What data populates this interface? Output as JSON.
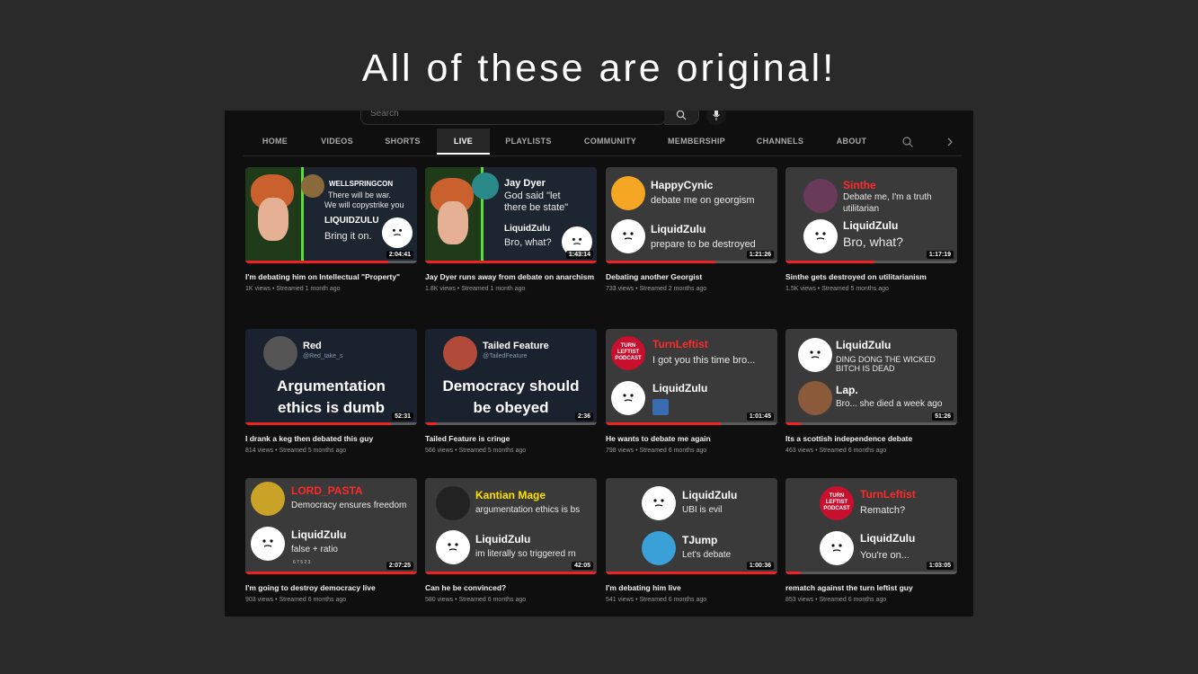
{
  "headline": "All of these are original!",
  "search": {
    "placeholder": "Search"
  },
  "tabs": [
    "HOME",
    "VIDEOS",
    "SHORTS",
    "LIVE",
    "PLAYLISTS",
    "COMMUNITY",
    "MEMBERSHIP",
    "CHANNELS",
    "ABOUT"
  ],
  "active_tab": "LIVE",
  "colors": {
    "accent_red": "#ff2a2a",
    "yellow": "#ffe100",
    "progress": "#e22222",
    "card_bg": "#3a3a3d"
  },
  "videos": [
    {
      "title": "I'm debating him on Intellectual \"Property\"",
      "meta": "1K views • Streamed 1 month ago",
      "duration": "2:04:41",
      "progress": 0.83,
      "thumb": {
        "n1": "WELLSPRINGCON",
        "l1": "There will be war.",
        "l1b": "We will copystrike you",
        "n2": "LIQUIDZULU",
        "l2": "Bring it on."
      }
    },
    {
      "title": "Jay Dyer runs away from debate on anarchism",
      "meta": "1.8K views • Streamed 1 month ago",
      "duration": "1:43:14",
      "progress": 1.0,
      "thumb": {
        "n1": "Jay Dyer",
        "l1": "God said \"let",
        "l1b": "there be state\"",
        "n2": "LiquidZulu",
        "l2": "Bro, what?"
      }
    },
    {
      "title": "Debating another Georgist",
      "meta": "733 views • Streamed 2 months ago",
      "duration": "1:21:26",
      "progress": 0.64,
      "thumb": {
        "n1": "HappyCynic",
        "l1": "debate me on georgism",
        "n2": "LiquidZulu",
        "l2": "prepare to be destroyed"
      }
    },
    {
      "title": "Sinthe gets destroyed on utilitarianism",
      "meta": "1.5K views • Streamed 5 months ago",
      "duration": "1:17:19",
      "progress": 0.52,
      "thumb": {
        "n1": "Sinthe",
        "l1": "Debate me, I'm a truth",
        "l1b": "utilitarian",
        "n2": "LiquidZulu",
        "l2": "Bro, what?"
      }
    },
    {
      "title": "I drank a keg then debated this guy",
      "meta": "814 views • Streamed 5 months ago",
      "duration": "52:31",
      "progress": 0.85,
      "thumb": {
        "n1": "Red",
        "handle": "@Red_take_s",
        "big1": "Argumentation",
        "big2": "ethics is dumb"
      }
    },
    {
      "title": "Tailed Feature is cringe",
      "meta": "566 views • Streamed 5 months ago",
      "duration": "2:36",
      "progress": 0.07,
      "thumb": {
        "n1": "Tailed Feature",
        "handle": "@TailedFeature",
        "big1": "Democracy should",
        "big2": "be obeyed"
      }
    },
    {
      "title": "He wants to debate me again",
      "meta": "798 views • Streamed 6 months ago",
      "duration": "1:01:45",
      "progress": 0.67,
      "thumb": {
        "n1": "TurnLeftist",
        "l1": "I got you this time bro...",
        "n2": "LiquidZulu",
        "logo": "TURN LEFTIST PODCAST"
      }
    },
    {
      "title": "Its a scottish independence debate",
      "meta": "463 views • Streamed 6 months ago",
      "duration": "51:26",
      "progress": 0.09,
      "thumb": {
        "n1": "LiquidZulu",
        "l1": "DING DONG THE WICKED",
        "l1b": "BITCH IS DEAD",
        "n2": "Lap.",
        "l2": "Bro... she died a week ago"
      }
    },
    {
      "title": "I'm going to destroy democracy live",
      "meta": "903 views • Streamed 6 months ago",
      "duration": "2:07:25",
      "progress": 1.0,
      "thumb": {
        "n1": "LORD_PASTA",
        "l1": "Democracy ensures freedom",
        "n2": "LiquidZulu",
        "l2": "false + ratio",
        "reacts": "6   7   5   2   3"
      }
    },
    {
      "title": "Can he be convinced?",
      "meta": "580 views • Streamed 6 months ago",
      "duration": "42:05",
      "progress": 1.0,
      "thumb": {
        "n1": "Kantian Mage",
        "l1": "argumentation ethics is bs",
        "n2": "LiquidZulu",
        "l2": "im literally so triggered rn"
      }
    },
    {
      "title": "I'm debating him live",
      "meta": "541 views • Streamed 6 months ago",
      "duration": "1:00:36",
      "progress": 1.0,
      "thumb": {
        "n1": "LiquidZulu",
        "l1": "UBI is evil",
        "n2": "TJump",
        "l2": "Let's debate"
      }
    },
    {
      "title": "rematch against the turn leftist guy",
      "meta": "853 views • Streamed 6 months ago",
      "duration": "1:03:05",
      "progress": 0.09,
      "thumb": {
        "n1": "TurnLeftist",
        "l1": "Rematch?",
        "n2": "LiquidZulu",
        "l2": "You're on...",
        "logo": "TURN LEFTIST PODCAST"
      }
    }
  ]
}
